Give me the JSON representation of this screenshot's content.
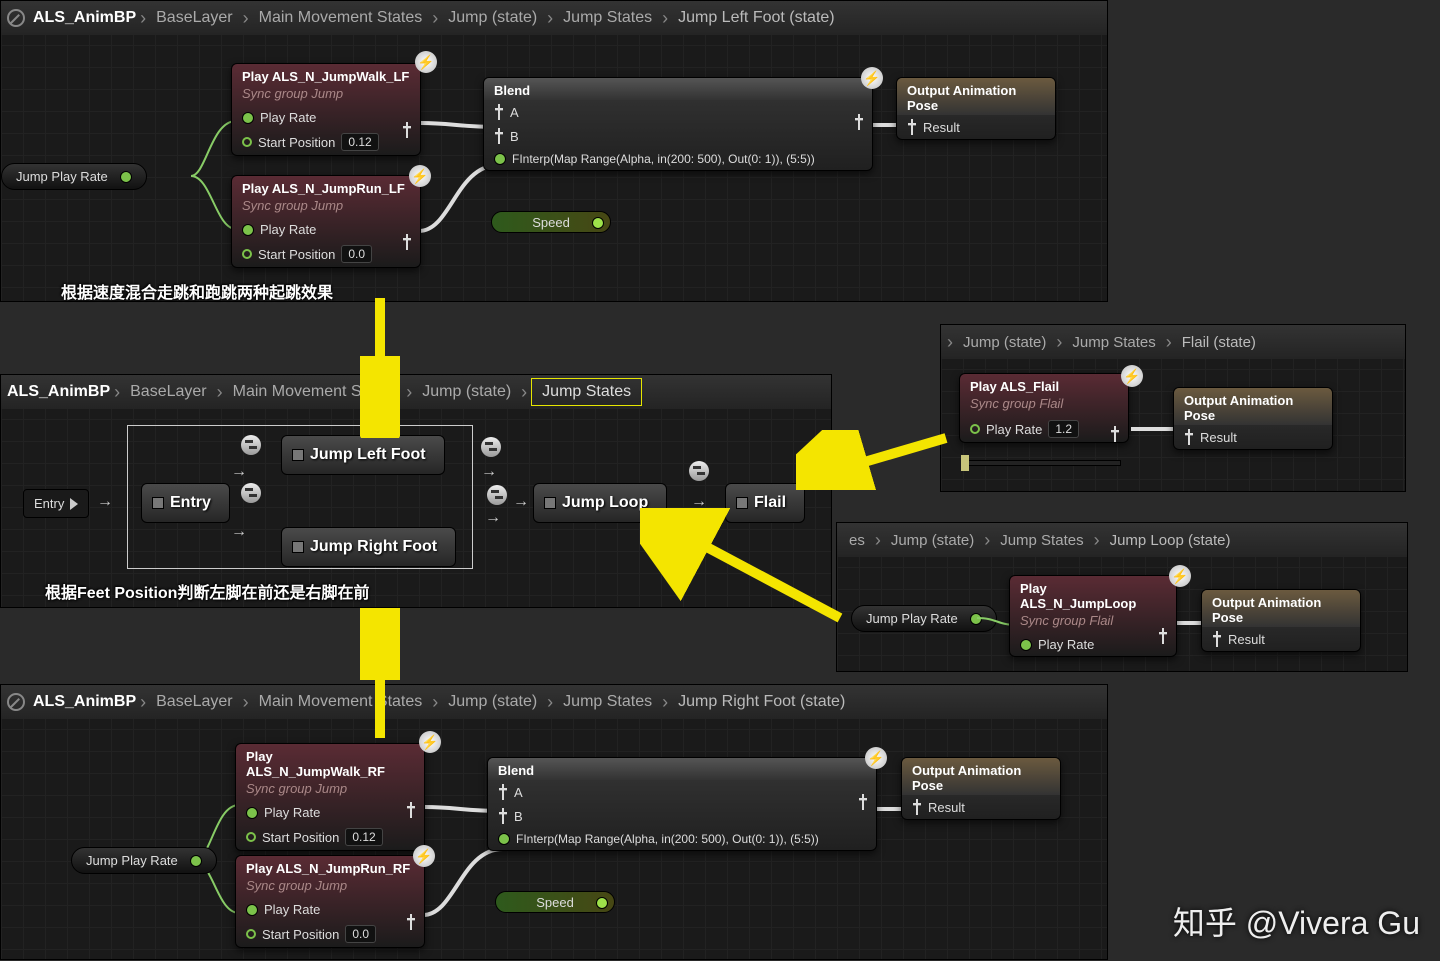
{
  "breadcrumbs": {
    "root": "ALS_AnimBP",
    "base": "BaseLayer",
    "mms": "Main Movement States",
    "jump": "Jump (state)",
    "jumpStates": "Jump States",
    "lf": "Jump Left Foot (state)",
    "rf": "Jump Right Foot (state)",
    "flail": "Flail (state)",
    "loop": "Jump Loop (state)",
    "partialEs": "es"
  },
  "chevron": "›",
  "nodes": {
    "playWalkLF": {
      "title": "Play ALS_N_JumpWalk_LF",
      "sub": "Sync group Jump"
    },
    "playRunLF": {
      "title": "Play ALS_N_JumpRun_LF",
      "sub": "Sync group Jump"
    },
    "playWalkRF": {
      "title": "Play ALS_N_JumpWalk_RF",
      "sub": "Sync group Jump"
    },
    "playRunRF": {
      "title": "Play ALS_N_JumpRun_RF",
      "sub": "Sync group Jump"
    },
    "playFlail": {
      "title": "Play ALS_Flail",
      "sub": "Sync group Flail"
    },
    "playLoop": {
      "title": "Play ALS_N_JumpLoop",
      "sub": "Sync group Flail"
    },
    "blend": "Blend",
    "output": "Output Animation Pose",
    "result": "Result"
  },
  "pins": {
    "playRate": "Play Rate",
    "startPos": "Start Position",
    "A": "A",
    "B": "B",
    "alpha": "FInterp(Map Range(Alpha, in(200: 500), Out(0: 1)), (5:5))",
    "jumpPlayRate": "Jump Play Rate",
    "speed": "Speed"
  },
  "values": {
    "sp012": "0.12",
    "sp00": "0.0",
    "rate12": "1.2"
  },
  "stateMachine": {
    "entryTab": "Entry",
    "entry": "Entry",
    "jlf": "Jump Left Foot",
    "jrf": "Jump Right Foot",
    "loop": "Jump Loop",
    "flail": "Flail"
  },
  "annotations": {
    "topCn": "根据速度混合走跳和跑跳两种起跳效果",
    "midCn": "根据Feet Position判断左脚在前还是右脚在前"
  },
  "watermark": "知乎 @Vivera Gu"
}
